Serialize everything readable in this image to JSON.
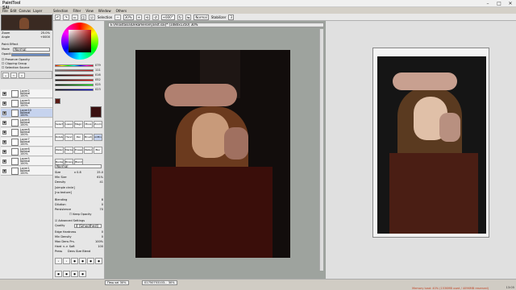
{
  "app": {
    "logo": "PaintTool SAI"
  },
  "menu": [
    "File",
    "Edit",
    "Canvas",
    "Layer",
    "Selection",
    "Filter",
    "View",
    "Window",
    "Others"
  ],
  "toolbar": {
    "selection_label": "Selection",
    "zoom": "30%",
    "rotation": "+000°",
    "blend_mode": "Normal",
    "stabilizer_label": "Stabilizer",
    "stabilizer_value": "3"
  },
  "navigator": {
    "zoom_label": "Zoom",
    "zoom_value": "25.0%",
    "angle_label": "Angle",
    "angle_value": "+0000"
  },
  "layer_props": {
    "paint_effect": "Paint Effect",
    "mode_label": "Mode",
    "mode_value": "Normal",
    "opacity_label": "Opacity",
    "opacity_value": "100%",
    "preserve": "Preserve Opacity",
    "clipping": "Clipping Group",
    "selection_source": "Selection Source"
  },
  "layers": [
    {
      "name": "Layer2",
      "mode": "Normal",
      "opacity": "100%"
    },
    {
      "name": "Layer9",
      "mode": "Normal",
      "opacity": "100%"
    },
    {
      "name": "Layer10",
      "mode": "Normal",
      "opacity": "100%"
    },
    {
      "name": "Layer4",
      "mode": "Normal",
      "opacity": "100%"
    },
    {
      "name": "Layer8",
      "mode": "Normal",
      "opacity": "100%"
    },
    {
      "name": "Layer7",
      "mode": "Normal",
      "opacity": "100%"
    },
    {
      "name": "Layer6",
      "mode": "Normal",
      "opacity": "100%"
    },
    {
      "name": "Layer5",
      "mode": "Normal",
      "opacity": "100%"
    },
    {
      "name": "Layer1",
      "mode": "Normal",
      "opacity": "100%"
    }
  ],
  "colors": {
    "accent": "#6a8bc2",
    "primary": "#5a1a14",
    "secondary": "#ffffff"
  },
  "color_sliders": [
    {
      "label": "H",
      "value": "079"
    },
    {
      "label": "S",
      "value": "111"
    },
    {
      "label": "V",
      "value": "016"
    },
    {
      "label": "R",
      "value": "052"
    },
    {
      "label": "G",
      "value": "025"
    },
    {
      "label": "B",
      "value": "023"
    }
  ],
  "tools": [
    "Select",
    "Lasso",
    "Magic",
    "Move",
    "Zoom",
    "Rotate",
    "Hand",
    "Pen",
    "Brush",
    "AirBrush",
    "Watercolor",
    "Marker",
    "Eraser",
    "Water",
    "Blur",
    "Bucket",
    "Binary",
    "Blend"
  ],
  "brush": {
    "mode": "Normal",
    "size_label": "Size",
    "size_mult": "x 0.8",
    "size_value": "25.0",
    "minsize_label": "Min Size",
    "minsize_value": "61%",
    "density_label": "Density",
    "density_value": "41",
    "shape": "[simple circle]",
    "texture": "[no texture]",
    "blending_label": "Blending",
    "blending_value": "8",
    "dilution_label": "Dilution",
    "dilution_value": "0",
    "persistence_label": "Persistence",
    "persistence_value": "70",
    "keep_opacity": "Keep Opacity",
    "advanced": "Advanced Settings",
    "quality_label": "Quality",
    "quality_value": "4 (Smoothest)",
    "edge_label": "Edge Hardness",
    "edge_value": "0",
    "min_density_label": "Min Density",
    "min_density_value": "0",
    "max_dens_label": "Max Dens Prs.",
    "max_dens_value": "100%",
    "hard_soft": "Hard <-> Soft",
    "hard_soft_value": "100",
    "press_label": "Press",
    "press_opts": "Dens Size Blend"
  },
  "document": {
    "title": "E:\\Anastasia\\Dekameron\\[anst.sai]* (1080x1350) 30%"
  },
  "statusbar": {
    "tab1": "Пеш.sai",
    "tab1_zoom": "30%",
    "tab2": "01750753103...",
    "tab2_zoom": "30%",
    "status": "Memory load: 40% (1536MB used / 4096MB reserved)",
    "time": "13:05"
  }
}
